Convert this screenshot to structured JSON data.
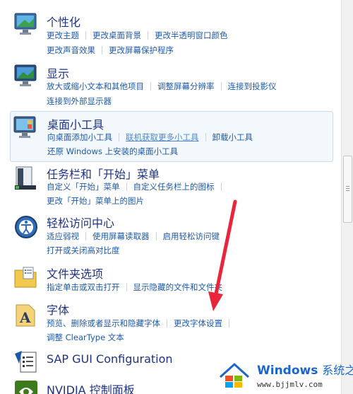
{
  "categories": [
    {
      "title": "个性化",
      "rows": [
        [
          "更改主题",
          "更改桌面背景",
          "更改半透明窗口颜色"
        ],
        [
          "更改声音效果",
          "更改屏幕保护程序"
        ]
      ]
    },
    {
      "title": "显示",
      "rows": [
        [
          "放大或缩小文本和其他项目",
          "调整屏幕分辨率",
          "连接到投影仪"
        ],
        [
          "连接到外部显示器"
        ]
      ]
    },
    {
      "title": "桌面小工具",
      "rows": [
        [
          "向桌面添加小工具",
          "联机获取更多小工具",
          "卸载小工具"
        ],
        [
          "还原 Windows 上安装的桌面小工具"
        ]
      ]
    },
    {
      "title": "任务栏和「开始」菜单",
      "rows": [
        [
          "自定义「开始」菜单",
          "自定义任务栏上的图标"
        ],
        [
          "更改「开始」菜单上的图片"
        ]
      ]
    },
    {
      "title": "轻松访问中心",
      "rows": [
        [
          "适应弱视",
          "使用屏幕读取器",
          "启用轻松访问键"
        ],
        [
          "打开或关闭高对比度"
        ]
      ]
    },
    {
      "title": "文件夹选项",
      "rows": [
        [
          "指定单击或双击打开",
          "显示隐藏的文件和文件夹"
        ]
      ]
    },
    {
      "title": "字体",
      "rows": [
        [
          "预览、删除或者显示和隐藏字体",
          "更改字体设置"
        ],
        [
          "调整 ClearType 文本"
        ]
      ]
    },
    {
      "title": "SAP GUI Configuration",
      "rows": []
    },
    {
      "title": "NVIDIA 控制面板",
      "rows": []
    }
  ],
  "watermark": {
    "brand": "Windows",
    "brand_cn": "系统之家",
    "url": "www.bjjmlv.com"
  },
  "colors": {
    "title": "#1e3287",
    "link": "#1d5aab",
    "highlight_bg": "#f3f8fd",
    "arrow": "#e8253a"
  }
}
